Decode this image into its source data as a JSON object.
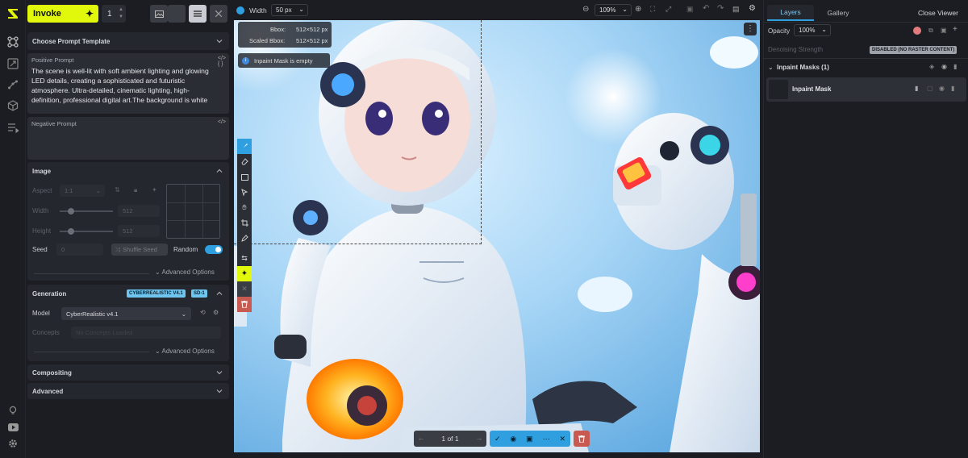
{
  "header": {
    "invoke_label": "Invoke",
    "quantity": "1"
  },
  "prompt_template": {
    "label": "Choose Prompt Template"
  },
  "positive_prompt": {
    "label": "Positive Prompt",
    "text": "The scene is well-lit with soft ambient lighting and glowing LED details, creating a sophisticated and futuristic atmosphere. Ultra-detailed, cinematic lighting, high-definition, professional digital art.The background is white"
  },
  "negative_prompt": {
    "label": "Negative Prompt",
    "text": ""
  },
  "image": {
    "title": "Image",
    "aspect_label": "Aspect",
    "aspect_value": "1:1",
    "width_label": "Width",
    "width_value": "512",
    "width_fraction": 0.21,
    "height_label": "Height",
    "height_value": "512",
    "height_fraction": 0.21,
    "seed_label": "Seed",
    "seed_value": "0",
    "shuffle_label": "Shuffle Seed",
    "random_label": "Random",
    "random_on": true,
    "advanced_label": "Advanced Options"
  },
  "generation": {
    "title": "Generation",
    "badges": [
      "CYBERREALISTIC V4.1",
      "SD-1"
    ],
    "model_label": "Model",
    "model_value": "CyberRealistic v4.1",
    "concepts_label": "Concepts",
    "concepts_placeholder": "No Concepts Loaded",
    "advanced_label": "Advanced Options"
  },
  "compositing": {
    "title": "Compositing"
  },
  "advanced": {
    "title": "Advanced"
  },
  "canvas_toolbar": {
    "width_label": "Width",
    "brush_width": "50 px",
    "zoom": "109%"
  },
  "canvas": {
    "bbox_label": "Bbox:",
    "bbox_value": "512×512 px",
    "scaled_label": "Scaled Bbox:",
    "scaled_value": "512×512 px",
    "mask_notice": "Inpaint Mask is empty",
    "pager": "1 of 1"
  },
  "right_panel": {
    "tab_layers": "Layers",
    "tab_gallery": "Gallery",
    "close_viewer": "Close Viewer",
    "opacity_label": "Opacity",
    "opacity_value": "100%",
    "denoise_label": "Denoising Strength",
    "denoise_badge": "DISABLED (NO RASTER CONTENT)",
    "inpaint_group": "Inpaint Masks (1)",
    "inpaint_item": "Inpaint Mask"
  },
  "colors": {
    "accent": "#e1f70b",
    "blue": "#2f9fe0",
    "danger": "#c95a52",
    "panel": "#24272d"
  }
}
